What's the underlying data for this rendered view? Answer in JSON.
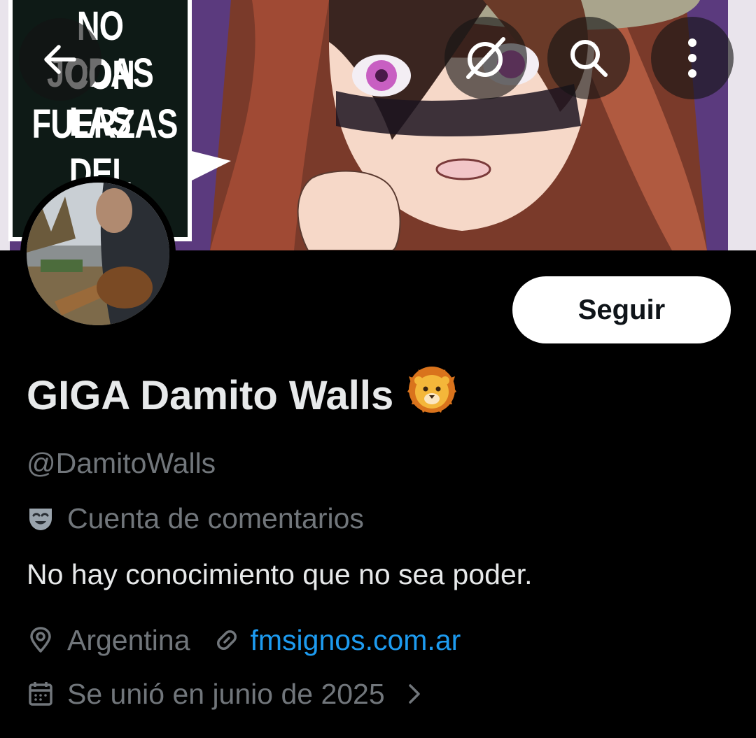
{
  "banner": {
    "speech_lines": [
      "NO JODAS",
      "CON LAS",
      "FUERZAS",
      "DEL CIELO."
    ]
  },
  "top_bar": {
    "back_icon": "arrow-left-icon",
    "grok_icon": "grok-slash-icon",
    "search_icon": "search-icon",
    "more_icon": "more-vertical-icon"
  },
  "profile": {
    "display_name": "GIGA Damito Walls",
    "name_emoji": "🦁",
    "handle": "@DamitoWalls",
    "category_icon": "theater-masks-icon",
    "category": "Cuenta de comentarios",
    "bio": "No hay conocimiento que no sea poder.",
    "location": "Argentina",
    "website": "fmsignos.com.ar",
    "joined": "Se unió en junio de 2025"
  },
  "actions": {
    "follow_label": "Seguir"
  },
  "colors": {
    "background": "#000000",
    "primary_text": "#e7e9ea",
    "secondary_text": "#71767b",
    "link": "#1d9bf0",
    "follow_bg": "#ffffff"
  }
}
